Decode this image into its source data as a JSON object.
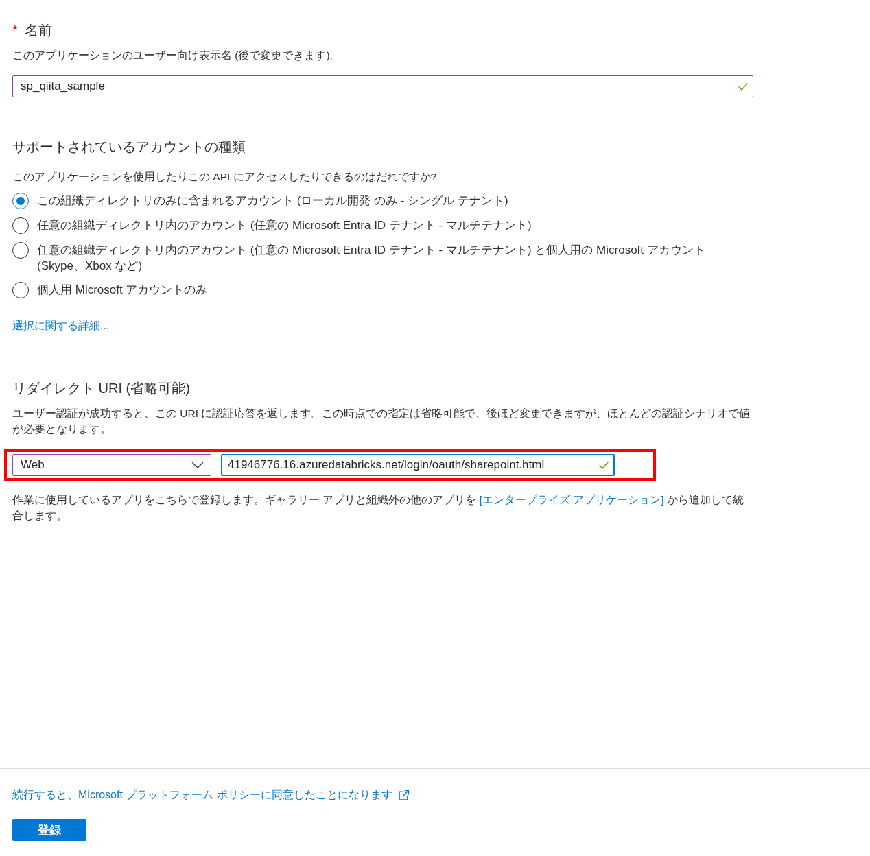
{
  "name_section": {
    "required_mark": "*",
    "title": "名前",
    "description": "このアプリケーションのユーザー向け表示名 (後で変更できます)。",
    "field": {
      "value": "sp_qiita_sample",
      "valid": true
    }
  },
  "account_types": {
    "title": "サポートされているアカウントの種類",
    "question": "このアプリケーションを使用したりこの API にアクセスしたりできるのはだれですか?",
    "options": [
      {
        "label": "この組織ディレクトリのみに含まれるアカウント (ローカル開発 のみ - シングル テナント)",
        "selected": true
      },
      {
        "label": "任意の組織ディレクトリ内のアカウント (任意の Microsoft Entra ID テナント - マルチテナント)",
        "selected": false
      },
      {
        "label": "任意の組織ディレクトリ内のアカウント (任意の Microsoft Entra ID テナント - マルチテナント) と個人用の Microsoft アカウント (Skype、Xbox など)",
        "selected": false
      },
      {
        "label": "個人用 Microsoft アカウントのみ",
        "selected": false
      }
    ],
    "help_link": "選択に関する詳細..."
  },
  "redirect_uri": {
    "title": "リダイレクト URI (省略可能)",
    "description": "ユーザー認証が成功すると、この URI に認証応答を返します。この時点での指定は省略可能で、後ほど変更できますが、ほとんどの認証シナリオで値が必要となります。",
    "highlighted": true,
    "platform": {
      "value": "Web"
    },
    "uri": {
      "value": "41946776.16.azuredatabricks.net/login/oauth/sharepoint.html",
      "valid": true,
      "focused": true
    },
    "note": {
      "before": "作業に使用しているアプリをこちらで登録します。ギャラリー アプリと組織外の他のアプリを",
      "link": "[エンタープライズ アプリケーション]",
      "after": "から追加して統合します。"
    }
  },
  "footer": {
    "policy_link": "続行すると、Microsoft プラットフォーム ポリシーに同意したことになります",
    "register_button": "登録"
  }
}
